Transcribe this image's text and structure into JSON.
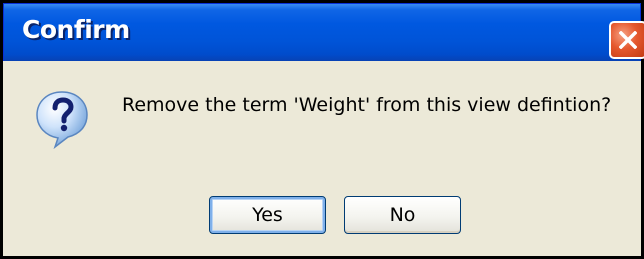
{
  "dialog": {
    "title": "Confirm",
    "message": "Remove the term 'Weight' from this view defintion?",
    "icon": "question-icon",
    "buttons": {
      "yes_label": "Yes",
      "no_label": "No"
    }
  },
  "colors": {
    "titlebar": "#0054e3",
    "close_button": "#e2552b",
    "dialog_background": "#ece9d8",
    "button_border": "#003c74"
  }
}
